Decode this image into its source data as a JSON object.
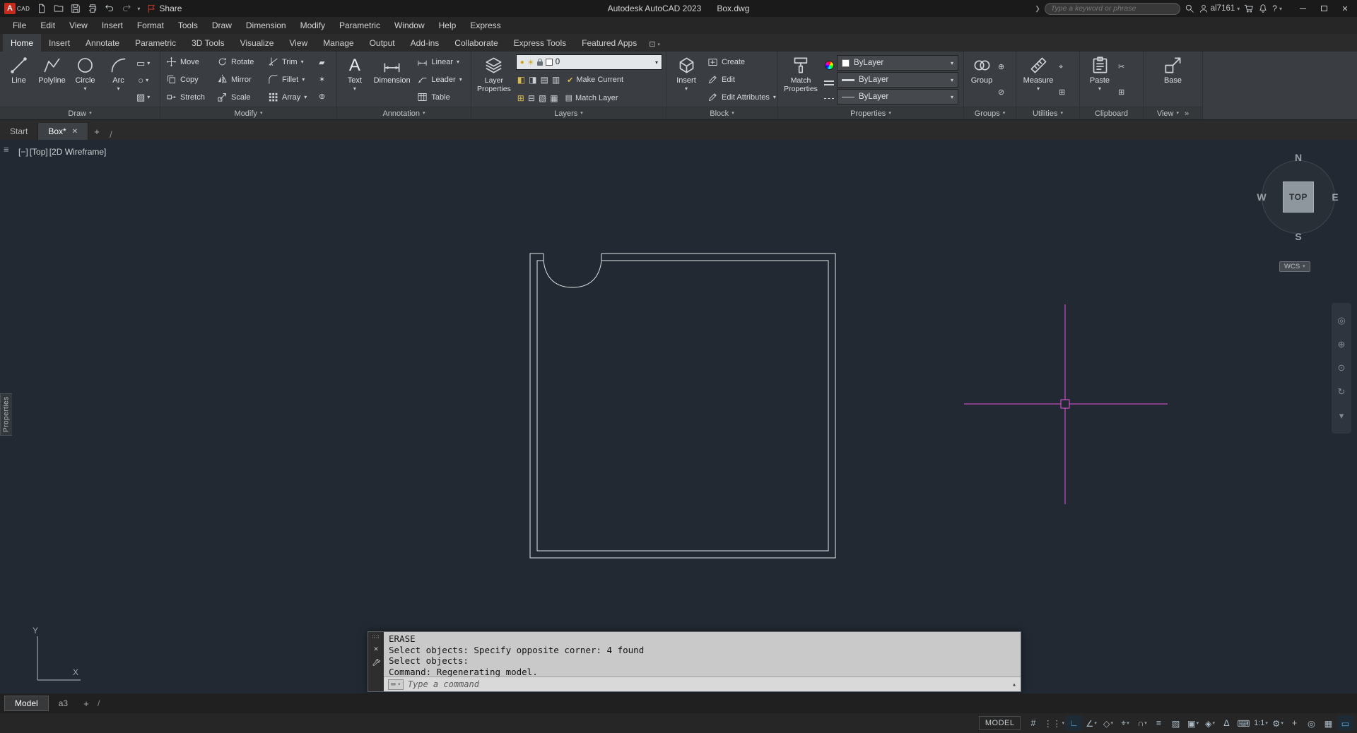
{
  "glyphs": {
    "caret": "▾",
    "up": "▴",
    "close": "✕",
    "plus": "+",
    "slash": "/",
    "hamburger": "≡",
    "grip": "∷∷",
    "keyboard": "⌨",
    "overflow": "»",
    "ribbon_toggle": "⊡",
    "qmark": "?"
  },
  "titlebar": {
    "share": "Share",
    "app_title": "Autodesk AutoCAD 2023",
    "doc_title": "Box.dwg",
    "search_placeholder": "Type a keyword or phrase",
    "username": "al7161"
  },
  "menubar": {
    "items": [
      "File",
      "Edit",
      "View",
      "Insert",
      "Format",
      "Tools",
      "Draw",
      "Dimension",
      "Modify",
      "Parametric",
      "Window",
      "Help",
      "Express"
    ]
  },
  "ribbon": {
    "tabs": [
      {
        "label": "Home",
        "name": "ribbon-tab-home",
        "cls": "active"
      },
      {
        "label": "Insert",
        "name": "ribbon-tab-insert"
      },
      {
        "label": "Annotate",
        "name": "ribbon-tab-annotate"
      },
      {
        "label": "Parametric",
        "name": "ribbon-tab-parametric"
      },
      {
        "label": "3D Tools",
        "name": "ribbon-tab-3d-tools"
      },
      {
        "label": "Visualize",
        "name": "ribbon-tab-visualize"
      },
      {
        "label": "View",
        "name": "ribbon-tab-view"
      },
      {
        "label": "Manage",
        "name": "ribbon-tab-manage"
      },
      {
        "label": "Output",
        "name": "ribbon-tab-output"
      },
      {
        "label": "Add-ins",
        "name": "ribbon-tab-add-ins"
      },
      {
        "label": "Collaborate",
        "name": "ribbon-tab-collaborate"
      },
      {
        "label": "Express Tools",
        "name": "ribbon-tab-express-tools"
      },
      {
        "label": "Featured Apps",
        "name": "ribbon-tab-featured-apps"
      }
    ]
  },
  "panels": {
    "draw": {
      "label": "Draw",
      "line": "Line",
      "polyline": "Polyline",
      "circle": "Circle",
      "arc": "Arc",
      "tools": [
        {
          "glyph": "▭",
          "name": "rectangle-tool-icon"
        },
        {
          "glyph": "○",
          "name": "ellipse-tool-icon"
        },
        {
          "glyph": "▨",
          "name": "hatch-tool-icon"
        }
      ]
    },
    "modify": {
      "label": "Modify",
      "move": "Move",
      "copy": "Copy",
      "stretch": "Stretch",
      "rotate": "Rotate",
      "mirror": "Mirror",
      "scale": "Scale",
      "trim": "Trim",
      "fillet": "Fillet",
      "array": "Array",
      "extra": [
        {
          "glyph": "▰",
          "name": "erase-tool-icon"
        },
        {
          "glyph": "✶",
          "name": "explode-tool-icon"
        },
        {
          "glyph": "⊚",
          "name": "offset-tool-icon"
        }
      ]
    },
    "annotation": {
      "label": "Annotation",
      "text": "Text",
      "text_icon": "A",
      "dimension": "Dimension",
      "linear": "Linear",
      "leader": "Leader",
      "table": "Table"
    },
    "layers": {
      "label": "Layers",
      "layer_properties": "Layer Properties",
      "current_layer": "0",
      "make_current": "Make Current",
      "match_layer": "Match Layer",
      "tools_row1": [
        {
          "glyph": "◧",
          "cls": "y"
        },
        {
          "glyph": "◨"
        },
        {
          "glyph": "▤"
        },
        {
          "glyph": "▥"
        }
      ],
      "tools_row2": [
        {
          "glyph": "⊞",
          "cls": "y"
        },
        {
          "glyph": "⊟"
        },
        {
          "glyph": "▧"
        },
        {
          "glyph": "▦"
        }
      ]
    },
    "block": {
      "label": "Block",
      "insert": "Insert",
      "create": "Create",
      "edit": "Edit",
      "edit_attributes": "Edit Attributes"
    },
    "properties": {
      "label": "Properties",
      "match_properties": "Match Properties",
      "color_value": "ByLayer",
      "lineweight_value": "ByLayer",
      "linetype_value": "ByLayer"
    },
    "groups": {
      "label": "Groups",
      "group": "Group",
      "side": [
        {
          "glyph": "⊕",
          "name": "ungroup-icon"
        },
        {
          "glyph": "⊘",
          "name": "group-edit-icon"
        }
      ]
    },
    "utilities": {
      "label": "Utilities",
      "measure": "Measure",
      "side": [
        {
          "glyph": "⌖",
          "name": "id-point-icon"
        },
        {
          "glyph": "⊞",
          "name": "quick-calc-icon"
        }
      ]
    },
    "clipboard": {
      "label": "Clipboard",
      "paste": "Paste",
      "side": [
        {
          "glyph": "✂",
          "name": "cut-icon"
        },
        {
          "glyph": "⊞",
          "name": "copy-clip-icon"
        }
      ]
    },
    "view": {
      "label": "View",
      "base": "Base"
    }
  },
  "file_tabs": {
    "start": "Start",
    "active": "Box*"
  },
  "viewport": {
    "collapse": "[−]",
    "view": "[Top]",
    "style": "[2D Wireframe]"
  },
  "viewcube": {
    "n": "N",
    "w": "W",
    "e": "E",
    "s": "S",
    "top": "TOP",
    "wcs": "WCS"
  },
  "panel_tab": {
    "label": "Properties"
  },
  "ucs": {
    "x": "X",
    "y": "Y"
  },
  "navbar": {
    "icons": [
      {
        "glyph": "◎",
        "name": "navbar-steering-wheel-icon"
      },
      {
        "glyph": "⊕",
        "name": "navbar-pan-icon"
      },
      {
        "glyph": "⊙",
        "name": "navbar-zoom-icon"
      },
      {
        "glyph": "↻",
        "name": "navbar-orbit-icon"
      },
      {
        "glyph": "▾",
        "name": "navbar-more-icon"
      }
    ]
  },
  "command": {
    "lines": [
      "ERASE",
      "Select objects: Specify opposite corner: 4 found",
      "Select objects:",
      "Command: Regenerating model."
    ],
    "placeholder": "Type a command"
  },
  "model_tabs": {
    "model": "Model",
    "a3": "a3"
  },
  "statusbar": {
    "model": "MODEL",
    "icons": [
      {
        "name": "status-grid-icon",
        "glyph": "#",
        "caret": ""
      },
      {
        "name": "status-snap-icon",
        "glyph": "⋮⋮",
        "caret": "▾"
      },
      {
        "name": "status-ortho-icon",
        "glyph": "∟",
        "caret": "",
        "cls": "active"
      },
      {
        "name": "status-polar-icon",
        "glyph": "∠",
        "caret": "▾"
      },
      {
        "name": "status-isodraft-icon",
        "glyph": "◇",
        "caret": "▾"
      },
      {
        "name": "status-otrack-icon",
        "glyph": "⌖",
        "caret": "▾"
      },
      {
        "name": "status-osnap-icon",
        "glyph": "∩",
        "caret": "▾"
      },
      {
        "name": "status-lineweight-icon",
        "glyph": "≡",
        "caret": ""
      },
      {
        "name": "status-transparency-icon",
        "glyph": "▨",
        "caret": ""
      },
      {
        "name": "status-selection-cycling-icon",
        "glyph": "▣",
        "caret": "▾"
      },
      {
        "name": "status-3d-osnap-icon",
        "glyph": "◈",
        "caret": "▾"
      },
      {
        "name": "status-dynamic-ucs-icon",
        "glyph": "∆",
        "caret": ""
      },
      {
        "name": "status-dynamic-input-icon",
        "glyph": "⌨",
        "caret": ""
      },
      {
        "name": "status-annotation-scale-icon",
        "glyph": "1:1",
        "caret": "▾",
        "cls": "wide"
      },
      {
        "name": "status-workspace-icon",
        "glyph": "⚙",
        "caret": "▾"
      },
      {
        "name": "status-customization-icon",
        "glyph": "+",
        "caret": ""
      },
      {
        "name": "status-isolate-icon",
        "glyph": "◎",
        "caret": ""
      },
      {
        "name": "status-performance-icon",
        "glyph": "▦",
        "caret": ""
      },
      {
        "name": "status-clean-screen-icon",
        "glyph": "▭",
        "caret": "",
        "cls": "active"
      }
    ]
  }
}
